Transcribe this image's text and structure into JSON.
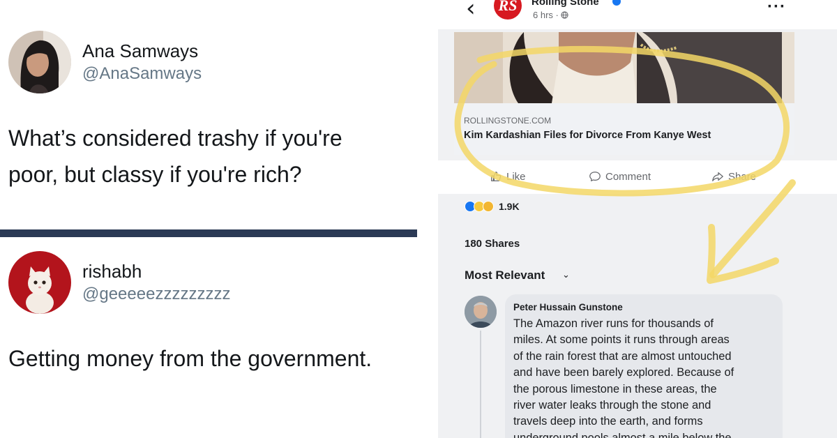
{
  "tweet1": {
    "name": "Ana Samways",
    "handle": "@AnaSamways",
    "text_lines": [
      "What’s considered trashy if you're",
      "poor, but classy if you're rich?"
    ]
  },
  "tweet2": {
    "name": "rishabh",
    "handle": "@geeeeezzzzzzzzz",
    "text_lines": [
      "Getting money from the government."
    ]
  },
  "facebook_post": {
    "page_name": "Rolling Stone",
    "logo_text": "RS",
    "time": "6 hrs · ",
    "link": {
      "domain": "ROLLINGSTONE.COM",
      "title": "Kim Kardashian Files for Divorce From Kanye West"
    },
    "actions": {
      "like": "Like",
      "comment": "Comment",
      "share": "Share"
    },
    "reaction_count": "1.9K",
    "shares": "180 Shares",
    "sort_label": "Most Relevant",
    "comment": {
      "author": "Peter Hussain Gunstone",
      "lines": [
        "The Amazon river runs for thousands of",
        "miles.  At some points it runs through areas",
        "of the rain forest that are almost untouched",
        "and have been barely explored.  Because of",
        "the porous limestone in these areas, the",
        "river water leaks through the stone and",
        "travels deep into the earth, and forms",
        "underground pools almost a mile below the"
      ]
    }
  },
  "colors": {
    "divider": "#2b3a55",
    "facebook_blue": "#1877f2",
    "rs_red": "#d71920",
    "highlighter": "#f3d766"
  }
}
